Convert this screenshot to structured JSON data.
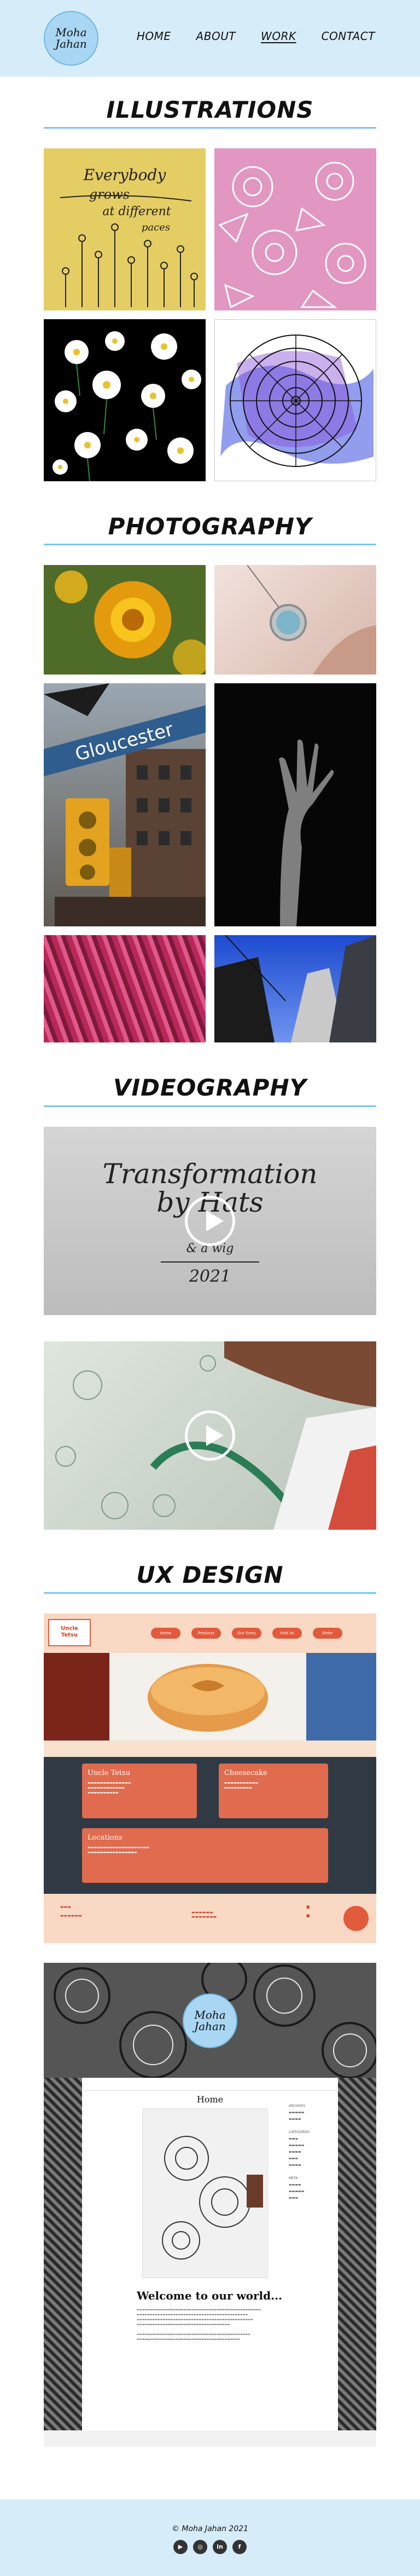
{
  "brand": {
    "logo_line1": "Moha",
    "logo_line2": "Jahan"
  },
  "nav": {
    "items": [
      {
        "label": "HOME"
      },
      {
        "label": "ABOUT"
      },
      {
        "label": "WORK",
        "active": true
      },
      {
        "label": "CONTACT"
      }
    ]
  },
  "sections": {
    "illustrations": "ILLUSTRATIONS",
    "photography": "PHOTOGRAPHY",
    "videography": "VIDEOGRAPHY",
    "ux": "UX DESIGN"
  },
  "illustrations": {
    "art1_line1": "Everybody",
    "art1_line2": "grows",
    "art1_line3": "at different",
    "art1_line4": "paces"
  },
  "photography": {
    "street_sign": "Gloucester"
  },
  "videos": {
    "v1_title_line1": "Transformation",
    "v1_title_line2": "by Hats",
    "v1_subtitle": "& a wig",
    "v1_year": "2021"
  },
  "ux": {
    "site1": {
      "logo_line1": "Uncle",
      "logo_line2": "Tetsu",
      "nav_pills": [
        "Home",
        "Products",
        "Our Story",
        "Visit Us",
        "Order"
      ],
      "card1_title": "Uncle Tetsu",
      "card2_title": "Cheesecake",
      "card3_title": "Locations"
    },
    "site2": {
      "page_heading": "Home",
      "welcome": "Welcome to our world...",
      "sidebar_label1": "ARCHIVES",
      "sidebar_label2": "CATEGORIES",
      "sidebar_label3": "META"
    }
  },
  "footer": {
    "copyright": "© Moha Jahan 2021",
    "socials": [
      {
        "name": "youtube-icon",
        "glyph": "▶"
      },
      {
        "name": "instagram-icon",
        "glyph": "◎"
      },
      {
        "name": "linkedin-icon",
        "glyph": "in"
      },
      {
        "name": "facebook-icon",
        "glyph": "f"
      }
    ]
  },
  "colors": {
    "header_bg": "#d6ecf9",
    "accent_rule": "#7ec3ef",
    "logo_bg": "#a9d6f3"
  }
}
